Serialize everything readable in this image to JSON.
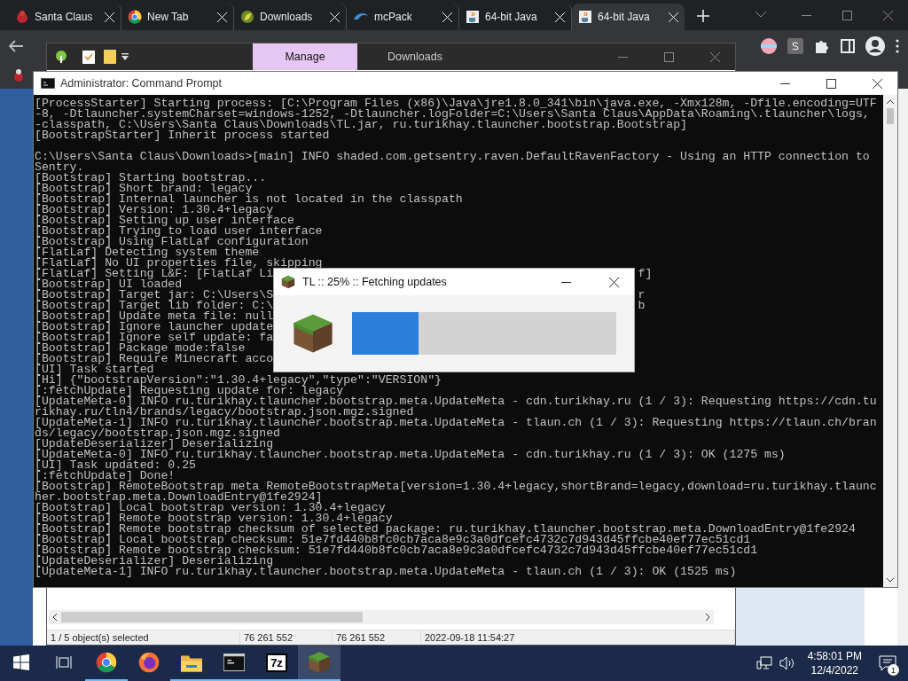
{
  "browser": {
    "tabs": [
      {
        "label": "Santa Claus",
        "kind": "santa",
        "selected": false
      },
      {
        "label": "New Tab",
        "kind": "chrome",
        "selected": false
      },
      {
        "label": "Downloads",
        "kind": "leaf",
        "selected": false
      },
      {
        "label": "mcPack",
        "kind": "swirl",
        "selected": false
      },
      {
        "label": "64-bit Java",
        "kind": "java",
        "selected": false
      },
      {
        "label": "64-bit Java",
        "kind": "java",
        "selected": true
      }
    ]
  },
  "file_window": {
    "ribbon_tabs": [
      {
        "label": "Manage",
        "selected": true
      },
      {
        "label": "Downloads",
        "selected": false
      }
    ],
    "status_bar": [
      "1 / 5 object(s) selected",
      "76 261 552",
      "76 261 552",
      "2022-09-18 11:54:27"
    ]
  },
  "console": {
    "title": "Administrator: Command Prompt",
    "lines": [
      {
        "kind": "text",
        "text": "[ProcessStarter] Starting process: [C:\\Program Files (x86)\\Java\\jre1.8.0_341\\bin\\java.exe, -Xmx128m, -Dfile.encoding=UTF"
      },
      {
        "kind": "text",
        "text": "-8, -Dtlauncher.systemCharset=windows-1252, -Dtlauncher.logFolder=C:\\Users\\Santa Claus\\AppData\\Roaming\\.tlauncher\\logs,"
      },
      {
        "kind": "text",
        "text": "-classpath, C:\\Users\\Santa Claus\\Downloads\\TL.jar, ru.turikhay.tlauncher.bootstrap.Bootstrap]"
      },
      {
        "kind": "text",
        "text": "[BootstrapStarter] Inherit process started"
      },
      {
        "kind": "blank"
      },
      {
        "kind": "text",
        "text": "C:\\Users\\Santa Claus\\Downloads>[main] INFO shaded.com.getsentry.raven.DefaultRavenFactory - Using an HTTP connection to"
      },
      {
        "kind": "text",
        "text": "Sentry."
      },
      {
        "kind": "text",
        "text": "[Bootstrap] Starting bootstrap..."
      },
      {
        "kind": "text",
        "text": "[Bootstrap] Short brand: legacy"
      },
      {
        "kind": "text",
        "text": "[Bootstrap] Internal launcher is not located in the classpath"
      },
      {
        "kind": "text",
        "text": "[Bootstrap] Version: 1.30.4+legacy"
      },
      {
        "kind": "text",
        "text": "[Bootstrap] Setting up user interface"
      },
      {
        "kind": "text",
        "text": "[Bootstrap] Trying to load user interface"
      },
      {
        "kind": "text",
        "text": "[Bootstrap] Using FlatLaf configuration"
      },
      {
        "kind": "text",
        "text": "[FlatLaf] Detecting system theme"
      },
      {
        "kind": "text",
        "text": "[FlatLaf] No UI properties file, skipping"
      },
      {
        "kind": "text",
        "text": "[FlatLaf] Setting L&F: [FlatLaf Li",
        "tail": "f]"
      },
      {
        "kind": "text",
        "text": "[Bootstrap] UI loaded"
      },
      {
        "kind": "text",
        "text": "[Bootstrap] Target jar: C:\\Users\\S",
        "tail": "r"
      },
      {
        "kind": "text",
        "text": "[Bootstrap] Target lib folder: C:\\",
        "tail": "b"
      },
      {
        "kind": "text",
        "text": "[Bootstrap] Update meta file: null"
      },
      {
        "kind": "text",
        "text": "[Bootstrap] Ignore launcher update"
      },
      {
        "kind": "text",
        "text": "[Bootstrap] Ignore self update: fa"
      },
      {
        "kind": "text",
        "text": "[Bootstrap] Package mode:false"
      },
      {
        "kind": "text",
        "text": "[Bootstrap] Require Minecraft acco"
      },
      {
        "kind": "text",
        "text": "[UI] Task started"
      },
      {
        "kind": "text",
        "text": "[Hi] {\"bootstrapVersion\":\"1.30.4+legacy\",\"type\":\"VERSION\"}"
      },
      {
        "kind": "text",
        "text": "[:fetchUpdate] Requesting update for: legacy"
      },
      {
        "kind": "text",
        "text": "[UpdateMeta-0] INFO ru.turikhay.tlauncher.bootstrap.meta.UpdateMeta - cdn.turikhay.ru (1 / 3): Requesting https://cdn.tu"
      },
      {
        "kind": "text",
        "text": "rikhay.ru/tln4/brands/legacy/bootstrap.json.mgz.signed"
      },
      {
        "kind": "text",
        "text": "[UpdateMeta-1] INFO ru.turikhay.tlauncher.bootstrap.meta.UpdateMeta - tlaun.ch (1 / 3): Requesting https://tlaun.ch/bran"
      },
      {
        "kind": "text",
        "text": "ds/legacy/bootstrap.json.mgz.signed"
      },
      {
        "kind": "text",
        "text": "[UpdateDeserializer] Deserializing"
      },
      {
        "kind": "text",
        "text": "[UpdateMeta-0] INFO ru.turikhay.tlauncher.bootstrap.meta.UpdateMeta - cdn.turikhay.ru (1 / 3): OK (1275 ms)"
      },
      {
        "kind": "text",
        "text": "[UI] Task updated: 0.25"
      },
      {
        "kind": "text",
        "text": "[:fetchUpdate] Done!"
      },
      {
        "kind": "text",
        "text": "[Bootstrap] RemoteBootstrap meta RemoteBootstrapMeta[version=1.30.4+legacy,shortBrand=legacy,download=ru.turikhay.tlaunc"
      },
      {
        "kind": "text",
        "text": "her.bootstrap.meta.DownloadEntry@1fe2924]"
      },
      {
        "kind": "text",
        "text": "[Bootstrap] Local bootstrap version: 1.30.4+legacy"
      },
      {
        "kind": "text",
        "text": "[Bootstrap] Remote bootstrap version: 1.30.4+legacy"
      },
      {
        "kind": "text",
        "text": "[Bootstrap] Remote bootstrap checksum of selected package: ru.turikhay.tlauncher.bootstrap.meta.DownloadEntry@1fe2924"
      },
      {
        "kind": "text",
        "text": "[Bootstrap] Local bootstrap checksum: 51e7fd440b8fc0cb7aca8e9c3a0dfcefc4732c7d943d45ffcbe40ef77ec51cd1"
      },
      {
        "kind": "text",
        "text": "[Bootstrap] Remote bootstrap checksum: 51e7fd440b8fc0cb7aca8e9c3a0dfcefc4732c7d943d45ffcbe40ef77ec51cd1"
      },
      {
        "kind": "text",
        "text": "[UpdateDeserializer] Deserializing"
      },
      {
        "kind": "text",
        "text": "[UpdateMeta-1] INFO ru.turikhay.tlauncher.bootstrap.meta.UpdateMeta - tlaun.ch (1 / 3): OK (1525 ms)"
      }
    ]
  },
  "dialog": {
    "title": "TL :: 25% :: Fetching updates",
    "progress": {
      "level": 0.25
    }
  },
  "taskbar": {
    "apps": [
      {
        "kind": "chrome",
        "running": true,
        "selected": false
      },
      {
        "kind": "firefox",
        "running": false,
        "selected": false
      },
      {
        "kind": "explorer",
        "running": true,
        "selected": false
      },
      {
        "kind": "terminal",
        "running": true,
        "selected": false
      },
      {
        "kind": "archiver",
        "label": "7z",
        "running": true,
        "selected": false
      },
      {
        "kind": "grass",
        "running": true,
        "selected": true
      }
    ],
    "time": "4:58:01 PM",
    "date": "12/4/2022",
    "notifications": "1"
  }
}
